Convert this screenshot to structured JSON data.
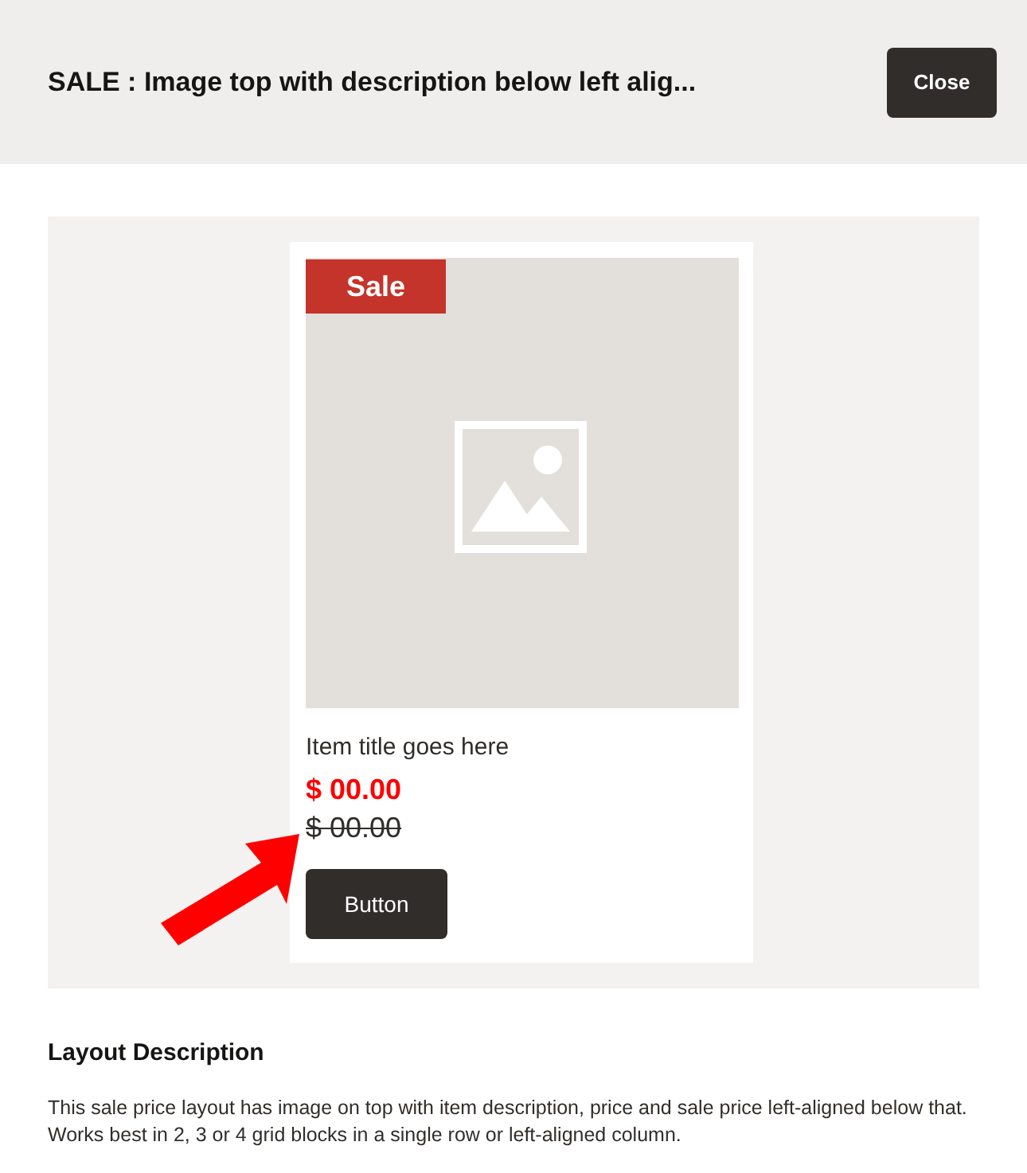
{
  "dialog": {
    "title": "SALE : Image top with description below left alig...",
    "close_button": "Close"
  },
  "preview": {
    "badge": "Sale",
    "item_title": "Item title goes here",
    "sale_price": "$ 00.00",
    "original_price": "$ 00.00",
    "button": "Button"
  },
  "description": {
    "heading": "Layout Description",
    "text": "This sale price layout has image on top with item description, price and sale price left-aligned below that. Works best in 2, 3 or 4 grid blocks in a single row or left-aligned column."
  }
}
